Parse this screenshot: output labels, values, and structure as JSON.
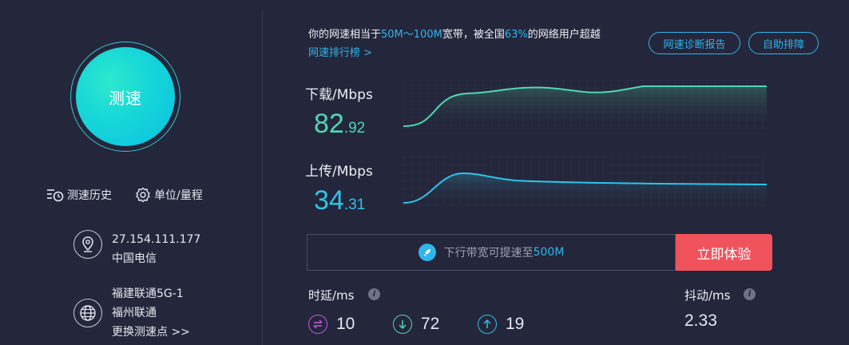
{
  "speedtest": {
    "button_label": "测速",
    "history_label": "测速历史",
    "units_label": "单位/量程"
  },
  "connection": {
    "ip": "27.154.111.177",
    "isp": "中国电信",
    "server_name": "福建联通5G-1",
    "server_isp": "福州联通",
    "change_server_link": "更换测速点 >>"
  },
  "summary": {
    "prefix": "你的网速相当于",
    "bandwidth": "50M～100M",
    "middle": "宽带，被全国",
    "percent": "63%",
    "suffix": "的网络用户超越",
    "rank_link": "网速排行榜 >",
    "diagnose_button": "网速诊断报告",
    "self_check_button": "自助排障"
  },
  "download": {
    "label": "下载/Mbps",
    "value_int": "82",
    "value_dec": ".92",
    "color": "#4fd8b2"
  },
  "upload": {
    "label": "上传/Mbps",
    "value_int": "34",
    "value_dec": ".31",
    "color": "#2ec4e8"
  },
  "promo": {
    "text_prefix": "下行带宽可提速至",
    "text_highlight": "500M",
    "button_label": "立即体验"
  },
  "latency": {
    "label": "时延/ms",
    "ping": "10",
    "down": "72",
    "up": "19"
  },
  "jitter": {
    "label": "抖动/ms",
    "value": "2.33"
  }
}
